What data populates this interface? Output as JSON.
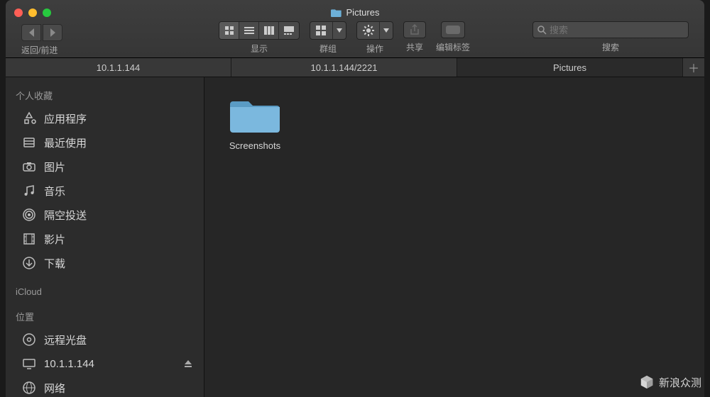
{
  "window": {
    "title": "Pictures"
  },
  "nav": {
    "back_forward_label": "返回/前进"
  },
  "toolbar": {
    "view_label": "显示",
    "group_label": "群组",
    "action_label": "操作",
    "share_label": "共享",
    "tags_label": "编辑标签",
    "search_label": "搜索",
    "search_placeholder": "搜索"
  },
  "tabs": [
    {
      "label": "10.1.1.144",
      "active": false
    },
    {
      "label": "10.1.1.144/2221",
      "active": false
    },
    {
      "label": "Pictures",
      "active": true
    }
  ],
  "sidebar": {
    "favorites_header": "个人收藏",
    "favorites": [
      {
        "label": "应用程序",
        "icon": "apps"
      },
      {
        "label": "最近使用",
        "icon": "recents"
      },
      {
        "label": "图片",
        "icon": "camera"
      },
      {
        "label": "音乐",
        "icon": "music"
      },
      {
        "label": "隔空投送",
        "icon": "airdrop"
      },
      {
        "label": "影片",
        "icon": "film"
      },
      {
        "label": "下载",
        "icon": "download"
      }
    ],
    "icloud_header": "iCloud",
    "locations_header": "位置",
    "locations": [
      {
        "label": "远程光盘",
        "icon": "disc",
        "eject": false
      },
      {
        "label": "10.1.1.144",
        "icon": "display",
        "eject": true
      },
      {
        "label": "网络",
        "icon": "globe",
        "eject": false
      }
    ]
  },
  "content": {
    "items": [
      {
        "name": "Screenshots",
        "type": "folder"
      }
    ]
  },
  "watermark": "新浪众测"
}
